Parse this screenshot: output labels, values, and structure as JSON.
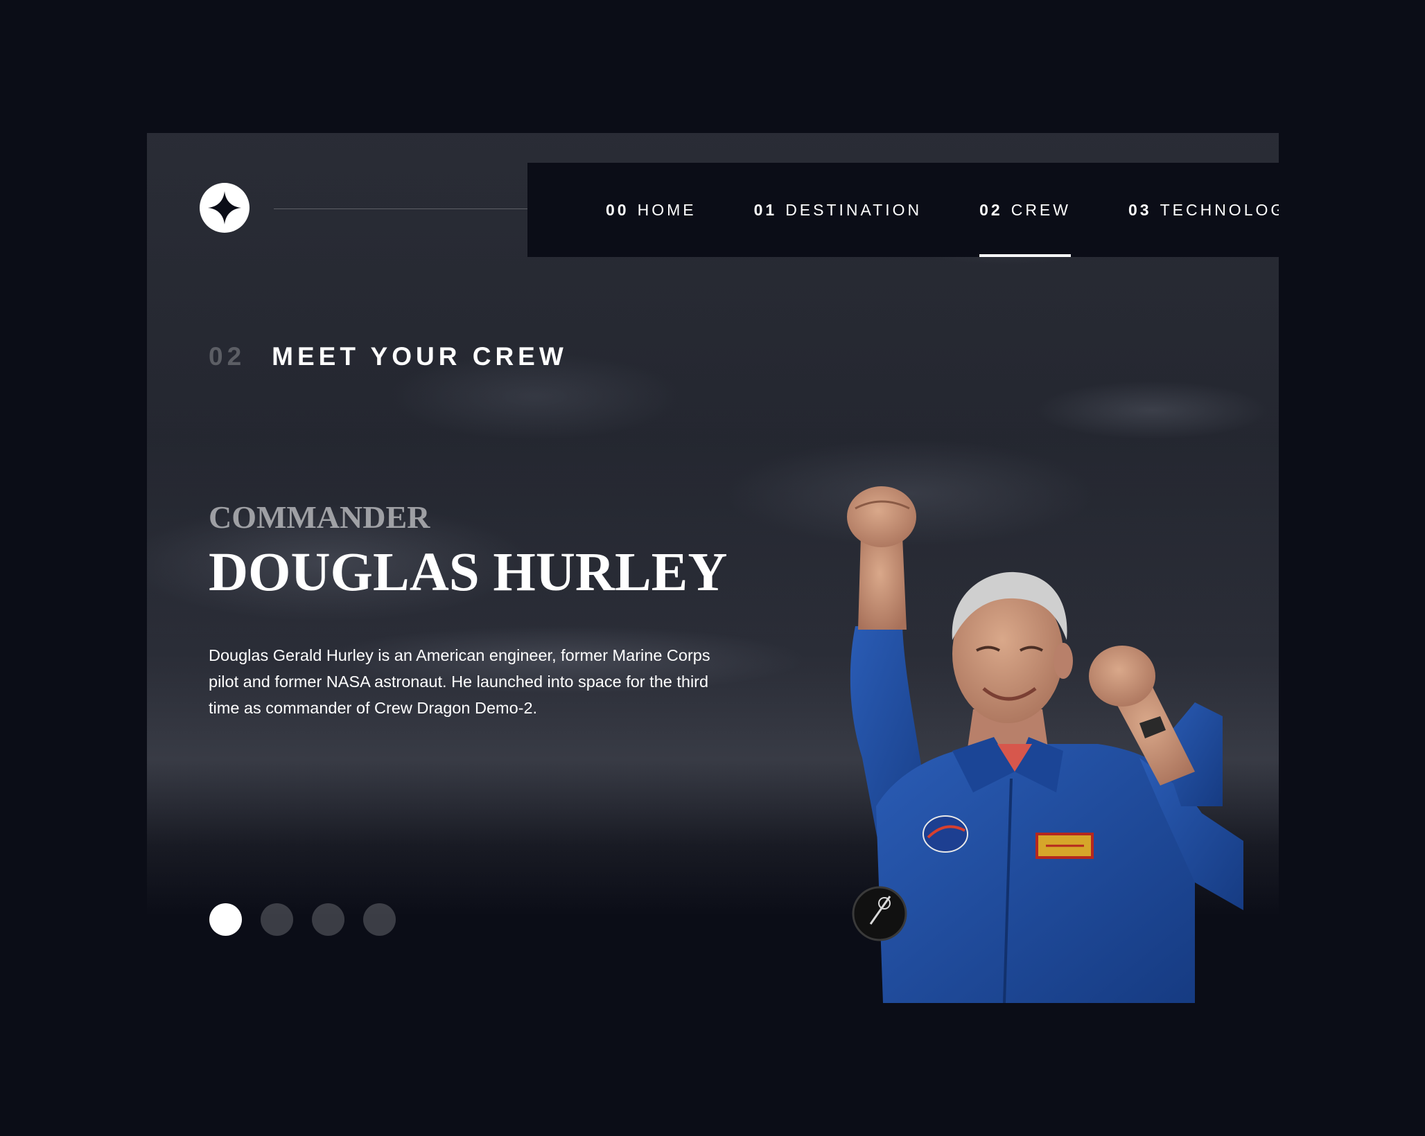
{
  "nav": {
    "items": [
      {
        "num": "00",
        "label": "HOME",
        "active": false
      },
      {
        "num": "01",
        "label": "DESTINATION",
        "active": false
      },
      {
        "num": "02",
        "label": "CREW",
        "active": true
      },
      {
        "num": "03",
        "label": "TECHNOLOGY",
        "active": false
      }
    ]
  },
  "page": {
    "eyebrow_num": "02",
    "eyebrow_label": "MEET YOUR CREW"
  },
  "crew": {
    "role": "Commander",
    "name": "DOUGLAS HURLEY",
    "bio": "Douglas Gerald Hurley is an American engineer, former Marine Corps pilot and former NASA astronaut. He launched into space for the third time as commander of Crew Dragon Demo-2.",
    "slide_count": 4,
    "active_slide": 1,
    "image_icon": "astronaut-portrait"
  },
  "colors": {
    "background": "#0b0d17",
    "text": "#ffffff",
    "suit_blue": "#1f4fa3",
    "dot_inactive": "rgba(255,255,255,0.2)"
  }
}
